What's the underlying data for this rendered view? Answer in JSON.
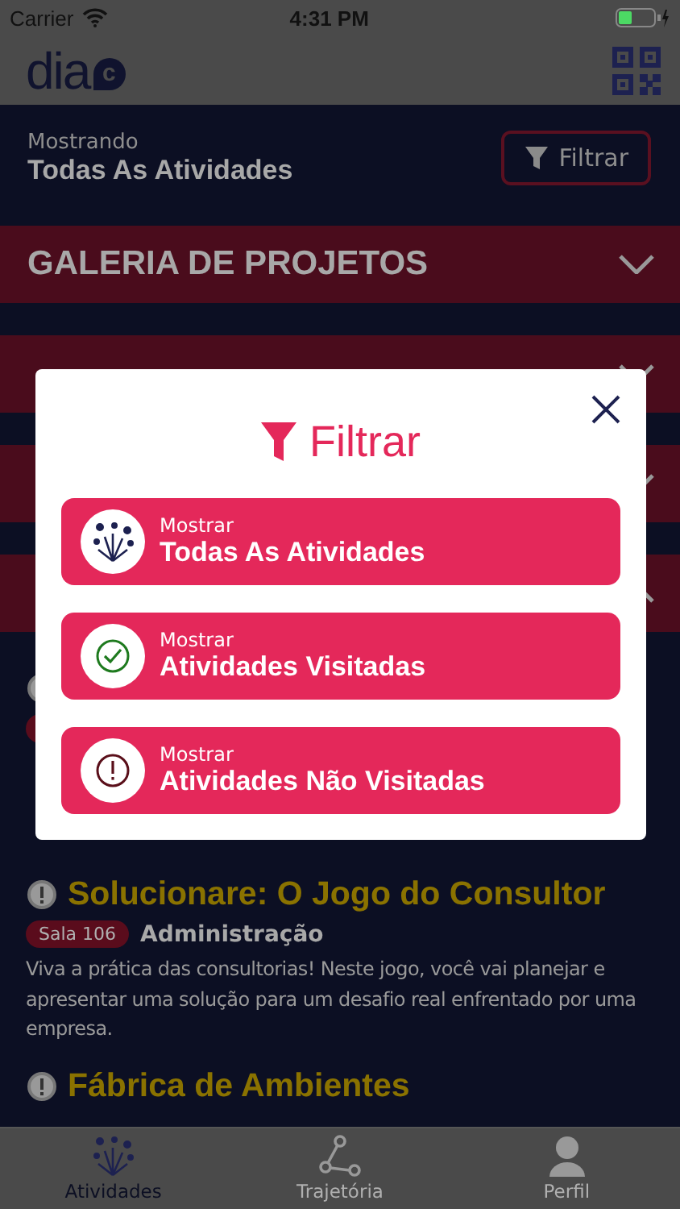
{
  "status_bar": {
    "carrier": "Carrier",
    "time": "4:31 PM"
  },
  "header": {
    "logo": "dia",
    "logo_badge": "c"
  },
  "filter_bar": {
    "caption": "Mostrando",
    "value": "Todas As Atividades",
    "button": "Filtrar"
  },
  "sections": [
    {
      "title": "GALERIA DE PROJETOS",
      "expanded": false
    },
    {
      "expanded": false
    },
    {
      "expanded": false
    },
    {
      "expanded": true
    }
  ],
  "activities": [
    {
      "kind": "partial",
      "visited": false
    },
    {
      "kind": "full",
      "visited": false,
      "title": "Solucionare: O Jogo do Consultor",
      "room": "Sala 106",
      "area": "Administração",
      "description": "Viva a prática das consultorias! Neste jogo, você vai planejar e apresentar uma solução para um desafio real enfrentado por uma empresa."
    },
    {
      "kind": "title",
      "visited": false,
      "title": "Fábrica de Ambientes"
    }
  ],
  "tabs": [
    {
      "label": "Atividades",
      "selected": true
    },
    {
      "label": "Trajetória",
      "selected": false
    },
    {
      "label": "Perfil",
      "selected": false
    }
  ],
  "modal": {
    "title": "Filtrar",
    "options": [
      {
        "kind": "all",
        "caption": "Mostrar",
        "label": "Todas As Atividades"
      },
      {
        "kind": "visited",
        "caption": "Mostrar",
        "label": "Atividades Visitadas"
      },
      {
        "kind": "unvisited",
        "caption": "Mostrar",
        "label": "Atividades Não Visitadas"
      }
    ]
  }
}
